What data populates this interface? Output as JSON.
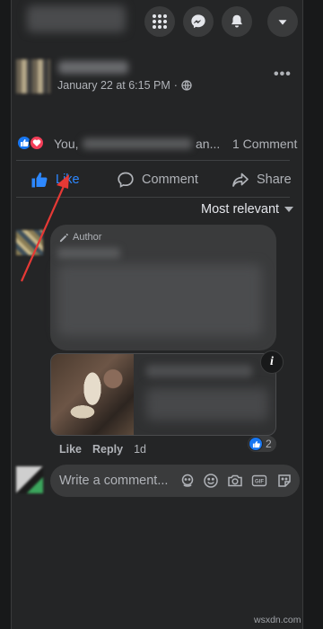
{
  "post": {
    "timestamp": "January 22 at 6:15 PM",
    "more": "•••"
  },
  "reactions": {
    "you_text": "You,",
    "and_text": "an...",
    "comment_count": "1 Comment"
  },
  "actions": {
    "like": "Like",
    "comment": "Comment",
    "share": "Share"
  },
  "sort": {
    "label": "Most relevant"
  },
  "comment": {
    "badge": "Author",
    "info_icon": "i",
    "like": "Like",
    "reply": "Reply",
    "age": "1d",
    "reaction_count": "2"
  },
  "composer": {
    "placeholder": "Write a comment..."
  },
  "colors": {
    "background": "#242526",
    "accent_blue": "#2d88ff",
    "love_red": "#f33e58",
    "annotation_arrow": "#e53935"
  },
  "watermark": "wsxdn.com"
}
